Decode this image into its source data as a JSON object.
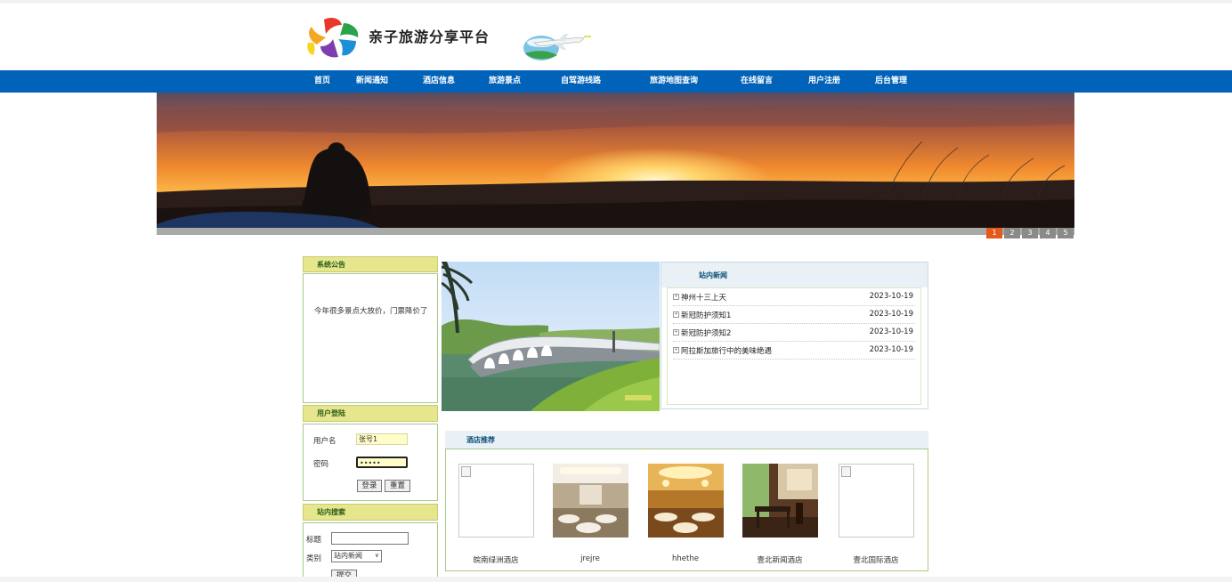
{
  "site": {
    "title": "亲子旅游分享平台"
  },
  "nav": [
    "首页",
    "新闻通知",
    "酒店信息",
    "旅游景点",
    "自驾游线路",
    "旅游地图查询",
    "在线留言",
    "用户注册",
    "后台管理"
  ],
  "banner": {
    "pages": [
      "1",
      "2",
      "3",
      "4",
      "5"
    ],
    "active": "1"
  },
  "notice": {
    "title": "系统公告",
    "text": "今年很多景点大放价，门票降价了"
  },
  "login": {
    "title": "用户登陆",
    "username_label": "用户名",
    "username_value": "张号1",
    "password_label": "密码",
    "password_value": "•••••",
    "login_button": "登录",
    "reset_button": "重置"
  },
  "search": {
    "title": "站内搜索",
    "title_label": "标题",
    "title_value": "",
    "category_label": "类别",
    "category_selected": "站内新闻",
    "search_button": "提交"
  },
  "news": {
    "title": "站内新闻",
    "items": [
      {
        "title": "神州十三上天",
        "date": "2023-10-19"
      },
      {
        "title": "新冠防护须知1",
        "date": "2023-10-19"
      },
      {
        "title": "新冠防护须知2",
        "date": "2023-10-19"
      },
      {
        "title": "阿拉斯加旅行中的美味绝遇",
        "date": "2023-10-19"
      }
    ]
  },
  "hotels": {
    "title": "酒店推荐",
    "items": [
      {
        "name": "皖南绿洲酒店",
        "image": "broken"
      },
      {
        "name": "jrejre",
        "image": "banquet-hall"
      },
      {
        "name": "hhethe",
        "image": "dining-hall"
      },
      {
        "name": "壹北新闻酒店",
        "image": "restaurant"
      },
      {
        "name": "壹北国际酒店",
        "image": "broken"
      }
    ]
  },
  "colors": {
    "nav": "#0062b8",
    "box_head": "#e6e68c",
    "active_page": "#e25b1c"
  }
}
